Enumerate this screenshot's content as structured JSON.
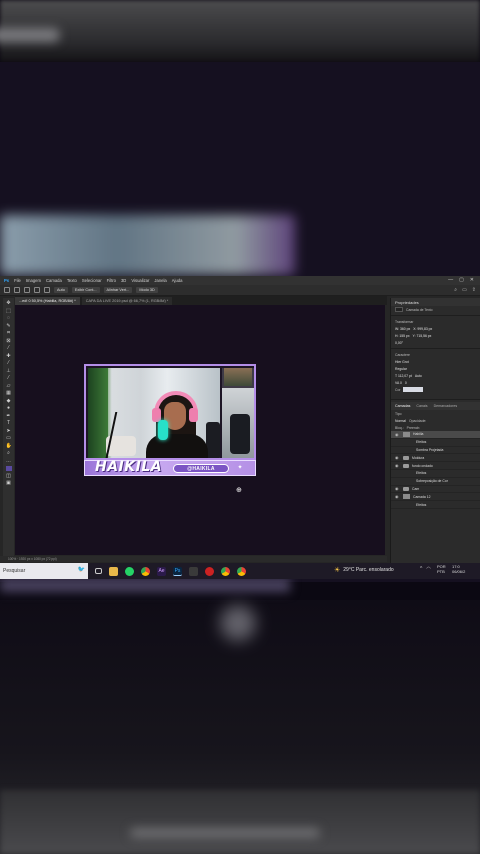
{
  "photoshop": {
    "menu": [
      "Ps",
      "File",
      "Imagem",
      "Camada",
      "Texto",
      "Selecionar",
      "Filtro",
      "3D",
      "Visualizar",
      "Janela",
      "Ajuda"
    ],
    "window_controls": [
      "—",
      "▢",
      "✕"
    ],
    "options_bar": {
      "auto_select": "Auto",
      "show_transform": "Exibir Cont...",
      "align_label": "Alinhar Vert...",
      "mode_label": "Modo 3D"
    },
    "tabs": [
      "...ed! 0 50,5% (Habilla, RGB/8#) *",
      "CAPA DA LIVE 2019.psd @ 66,7% (1, RGB/8#) *"
    ],
    "status": "100% · 1920 px x 1080 px (72 ppi)"
  },
  "artwork": {
    "brand_name": "HAIKILA",
    "pill_text": "@HAIKILA",
    "accent": "#b48ee8"
  },
  "properties": {
    "title": "Propriedades",
    "layer_kind": "Camada de Texto",
    "transform_title": "Transformar",
    "w": "W: 360 px",
    "x": "X: 999,83 px",
    "h": "H: 155 px",
    "y": "Y: 715,56 px",
    "angle": "0,00°",
    "char_title": "Caractere",
    "font": "Hier Grot",
    "style": "Regular",
    "size": "T 112,07 pt",
    "leading": "Auto",
    "kerning": "VA 0",
    "tracking": "0",
    "color_label": "Cor"
  },
  "layers": {
    "tabs": [
      "Camadas",
      "Canais",
      "Demarcadores"
    ],
    "filter_label": "Tipo",
    "blend_mode": "Normal",
    "opacity": "Opacidade:",
    "lock_label": "Bloq.:",
    "fill": "Preench:",
    "rows": [
      {
        "name": "Habilla",
        "eye": "◉",
        "type": "text",
        "selected": true
      },
      {
        "name": "Efeitos",
        "eye": "",
        "type": "sub",
        "selected": false
      },
      {
        "name": "Sombra Projetada",
        "eye": "",
        "type": "sub",
        "selected": false
      },
      {
        "name": "Moldura",
        "eye": "◉",
        "type": "folder",
        "selected": false
      },
      {
        "name": "fundo ondado",
        "eye": "◉",
        "type": "folder",
        "selected": false
      },
      {
        "name": "Efeitos",
        "eye": "",
        "type": "sub",
        "selected": false
      },
      {
        "name": "Sobreposição de Cor",
        "eye": "",
        "type": "sub",
        "selected": false
      },
      {
        "name": "Cam",
        "eye": "◉",
        "type": "folder",
        "selected": false
      },
      {
        "name": "Camada 12",
        "eye": "◉",
        "type": "layer",
        "selected": false
      },
      {
        "name": "Efeitos",
        "eye": "",
        "type": "sub",
        "selected": false
      }
    ]
  },
  "taskbar": {
    "search_placeholder": "Pesquisar",
    "weather": "29°C  Parc. ensolarado",
    "lang_top": "POR",
    "lang_bottom": "PTB",
    "time": "17:0",
    "date": "06/06/2"
  },
  "colors": {
    "ps_background": "#262626",
    "canvas": "#170f1e",
    "banner": "#c7a9f0",
    "mic_glow": "#27e0c8"
  }
}
